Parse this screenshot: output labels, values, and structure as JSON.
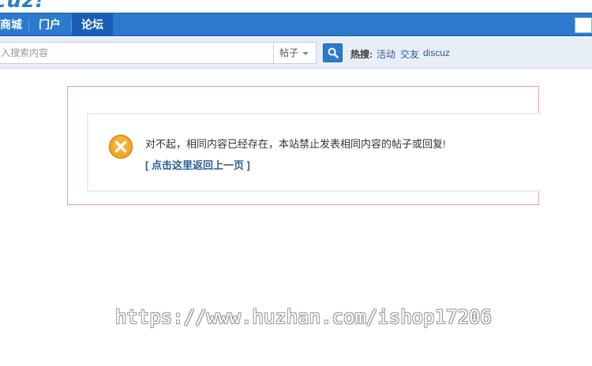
{
  "header": {
    "logo_text": "cuz!"
  },
  "nav": {
    "items": [
      {
        "label": "商城"
      },
      {
        "label": "门户"
      },
      {
        "label": "论坛"
      }
    ]
  },
  "search": {
    "placeholder": "入搜索内容",
    "type_selected": "帖子",
    "hot_label": "热搜:",
    "hot_links": [
      "活动",
      "交友",
      "discuz"
    ]
  },
  "alert": {
    "message": "对不起，相同内容已经存在，本站禁止发表相同内容的帖子或回复!",
    "back_link": "[ 点击这里返回上一页 ]"
  },
  "watermark": "https://www.huzhan.com/ishop17206",
  "colors": {
    "nav_bg": "#2b7acd",
    "nav_active": "#1a5fb4",
    "alert_border": "#f29b9b",
    "link": "#2a5e93",
    "error_icon": "#f5a623"
  }
}
